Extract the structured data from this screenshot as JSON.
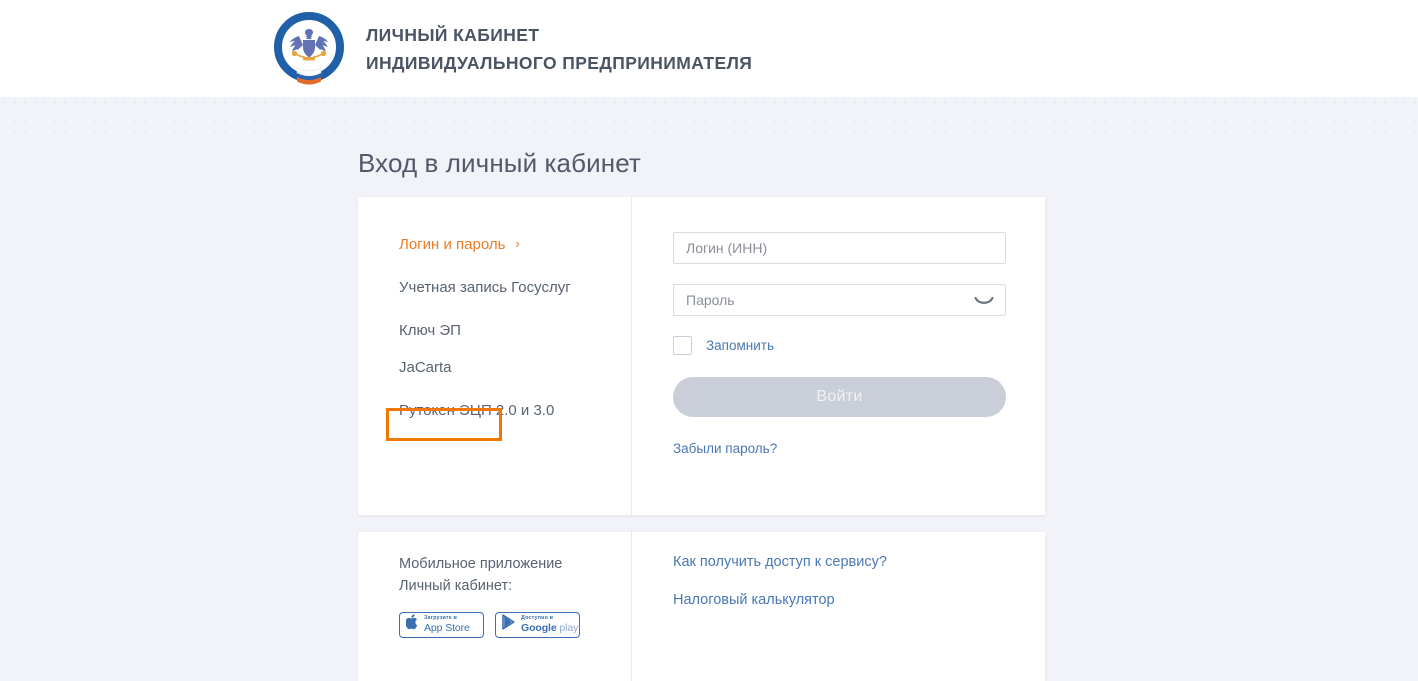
{
  "header": {
    "logo_name": "fns-emblem",
    "brand_line1": "ЛИЧНЫЙ КАБИНЕТ",
    "brand_line2": "ИНДИВИДУАЛЬНОГО ПРЕДПРИНИМАТЕЛЯ"
  },
  "page": {
    "title": "Вход в личный кабинет"
  },
  "login_methods": [
    {
      "label": "Логин и пароль",
      "chevron": "›",
      "state": "active"
    },
    {
      "label": "Учетная запись Госуслуг",
      "state": "normal"
    },
    {
      "label": "Ключ ЭП",
      "state": "highlighted"
    },
    {
      "label": "JaCarta",
      "state": "normal"
    },
    {
      "label": "Рутокен ЭЦП 2.0 и 3.0",
      "state": "normal"
    }
  ],
  "form": {
    "login_placeholder": "Логин (ИНН)",
    "login_value": "",
    "password_placeholder": "Пароль",
    "password_value": "",
    "password_toggle_icon": "eye-closed-icon",
    "remember_label": "Запомнить",
    "remember_checked": false,
    "submit_label": "Войти",
    "submit_disabled": true,
    "forgot_label": "Забыли пароль?"
  },
  "mobile": {
    "caption_line1": "Мобильное приложение",
    "caption_line2": "Личный кабинет:",
    "appstore": {
      "top": "Загрузите в",
      "main": "App Store",
      "icon": "apple-icon"
    },
    "googleplay": {
      "top": "Доступно в",
      "main_bold": "Google",
      "main_muted": "play",
      "icon": "google-play-icon"
    }
  },
  "help_links": [
    {
      "label": "Как получить доступ к сервису?"
    },
    {
      "label": "Налоговый калькулятор"
    }
  ],
  "colors": {
    "accent_orange": "#ec7c23",
    "highlight_orange": "#f07800",
    "link_blue": "#4a78b5",
    "brand_gray": "#4a5462",
    "page_bg": "#f2f3f9",
    "disabled_button": "#c9ced8"
  }
}
